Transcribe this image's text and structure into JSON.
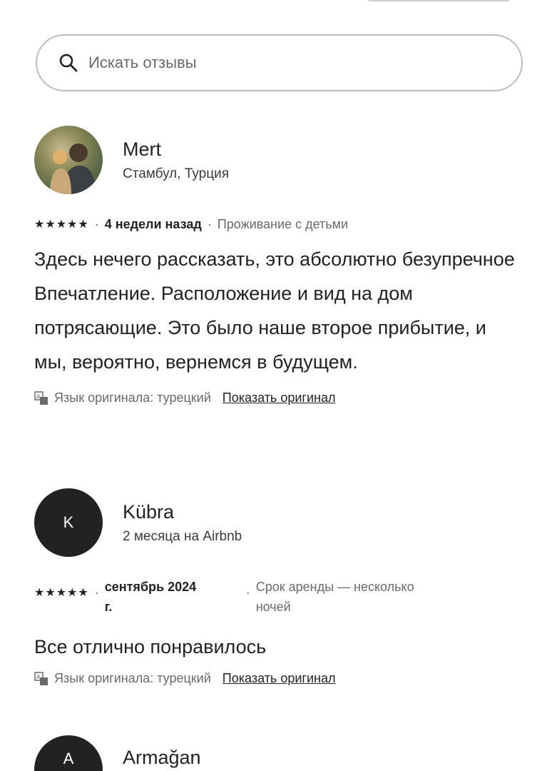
{
  "search": {
    "placeholder": "Искать отзывы"
  },
  "reviews": [
    {
      "name": "Mert",
      "subtitle": "Стамбул, Турция",
      "stars": "★★★★★",
      "when": "4 недели назад",
      "stay_type": "Проживание с детьми",
      "text": "Здесь нечего рассказать, это абсолютно безупречное Впечатление. Расположение и вид на дом потрясающие. Это было наше второе прибытие, и мы, вероятно, вернемся в будущем.",
      "original_language": "Язык оригинала: турецкий",
      "show_original": "Показать оригинал"
    },
    {
      "name": "Kübra",
      "avatar_letter": "K",
      "subtitle": "2 месяца на Airbnb",
      "stars": "★★★★★",
      "when_line1": "сентябрь 2024",
      "when_line2": "г.",
      "stay_type_line1": "Срок аренды — несколько",
      "stay_type_line2": "ночей",
      "text": "Все отлично понравилось",
      "original_language": "Язык оригинала: турецкий",
      "show_original": "Показать оригинал"
    },
    {
      "name": "Armağan",
      "avatar_letter": "A"
    }
  ]
}
